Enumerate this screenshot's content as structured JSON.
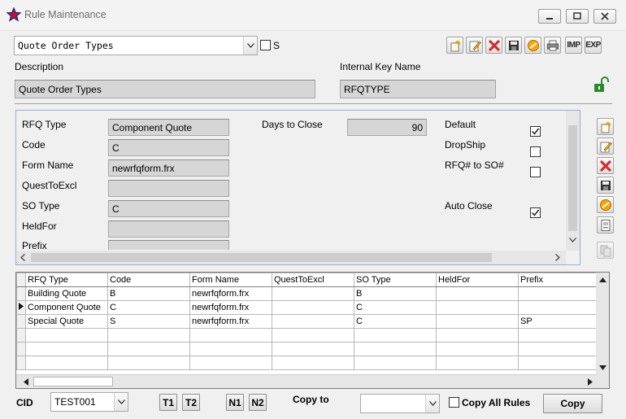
{
  "window": {
    "title": "Rule Maintenance"
  },
  "header": {
    "rule_select": "Quote Order Types",
    "s_label": "S",
    "s_checked": false,
    "description_label": "Description",
    "description_value": "Quote Order Types",
    "internal_key_label": "Internal Key Name",
    "internal_key_value": "RFQTYPE"
  },
  "toolbar": {
    "imp_label": "IMP",
    "exp_label": "EXP"
  },
  "detail": {
    "rfq_type_label": "RFQ Type",
    "rfq_type_value": "Component Quote",
    "code_label": "Code",
    "code_value": "C",
    "form_name_label": "Form Name",
    "form_name_value": "newrfqform.frx",
    "quest_label": "QuestToExcl",
    "quest_value": "",
    "so_type_label": "SO Type",
    "so_type_value": "C",
    "held_label": "HeldFor",
    "held_value": "",
    "prefix_label": "Prefix",
    "prefix_value": "",
    "days_label": "Days to Close",
    "days_value": "90",
    "default_label": "Default",
    "default_checked": true,
    "dropship_label": "DropShip",
    "dropship_checked": false,
    "rfq_so_label": "RFQ# to SO#",
    "rfq_so_checked": false,
    "auto_close_label": "Auto Close",
    "auto_close_checked": true
  },
  "grid": {
    "columns": [
      "RFQ Type",
      "Code",
      "Form Name",
      "QuestToExcl",
      "SO Type",
      "HeldFor",
      "Prefix"
    ],
    "rows": [
      [
        "Building Quote",
        "B",
        "newrfqform.frx",
        "",
        "B",
        "",
        ""
      ],
      [
        "Component Quote",
        "C",
        "newrfqform.frx",
        "",
        "C",
        "",
        ""
      ],
      [
        "Special Quote",
        "S",
        "newrfqform.frx",
        "",
        "C",
        "",
        "SP"
      ],
      [
        "",
        "",
        "",
        "",
        "",
        "",
        ""
      ],
      [
        "",
        "",
        "",
        "",
        "",
        "",
        ""
      ],
      [
        "",
        "",
        "",
        "",
        "",
        "",
        ""
      ]
    ],
    "current_row": 1
  },
  "footer": {
    "cid_label": "CID",
    "cid_value": "TEST001",
    "t1": "T1",
    "t2": "T2",
    "n1": "N1",
    "n2": "N2",
    "copy_to_label": "Copy to",
    "copy_to_value": "",
    "copy_all_label": "Copy All Rules",
    "copy_all_checked": false,
    "copy_button": "Copy"
  },
  "colors": {
    "panel_border": "#9ab0c9",
    "field_bg": "#d6d6d6",
    "window_bg": "#f0f0f0"
  }
}
